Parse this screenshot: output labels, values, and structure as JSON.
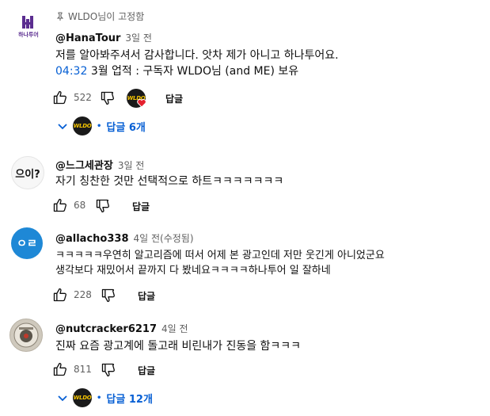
{
  "pinned_label": "WLDO님이 고정함",
  "comments": [
    {
      "handle": "@HanaTour",
      "time": "3일 전",
      "avatar_label": "하나투어",
      "line1": "저를 알아봐주셔서 감사합니다. 앗차 제가 아니고 하나투어요.",
      "line2_time": "04:32",
      "line2_text": "3월 업적 : 구독자 WLDO님 (and ME) 보유",
      "likes": "522",
      "reply": "답글",
      "replies_toggle": "답글 6개",
      "creator_badge": "WLDO"
    },
    {
      "handle": "@느그세관장",
      "time": "3일 전",
      "avatar_label": "으이?",
      "line1": "자기 칭찬한 것만 선택적으로 하트ㅋㅋㅋㅋㅋㅋㅋ",
      "likes": "68",
      "reply": "답글"
    },
    {
      "handle": "@allacho338",
      "time": "4일 전(수정됨)",
      "avatar_label": "ㅇㄹ",
      "line1": "ㅋㅋㅋㅋㅋ우연히 알고리즘에 떠서 어제 본 광고인데 저만 웃긴게 아니었군요",
      "line2": "생각보다 재밌어서 끝까지 다 봤네요ㅋㅋㅋㅋ하나투어 일 잘하네",
      "likes": "228",
      "reply": "답글"
    },
    {
      "handle": "@nutcracker6217",
      "time": "4일 전",
      "line1": "진짜 요즘 광고계에 돌고래 비린내가 진동을 함ㅋㅋㅋ",
      "likes": "811",
      "reply": "답글",
      "replies_toggle": "답글 12개",
      "creator_badge": "WLDO"
    }
  ],
  "colors": {
    "link": "#065fd4",
    "heart": "#e5202e",
    "badge_bg": "#1a1a1a",
    "badge_text": "#f5c400"
  }
}
